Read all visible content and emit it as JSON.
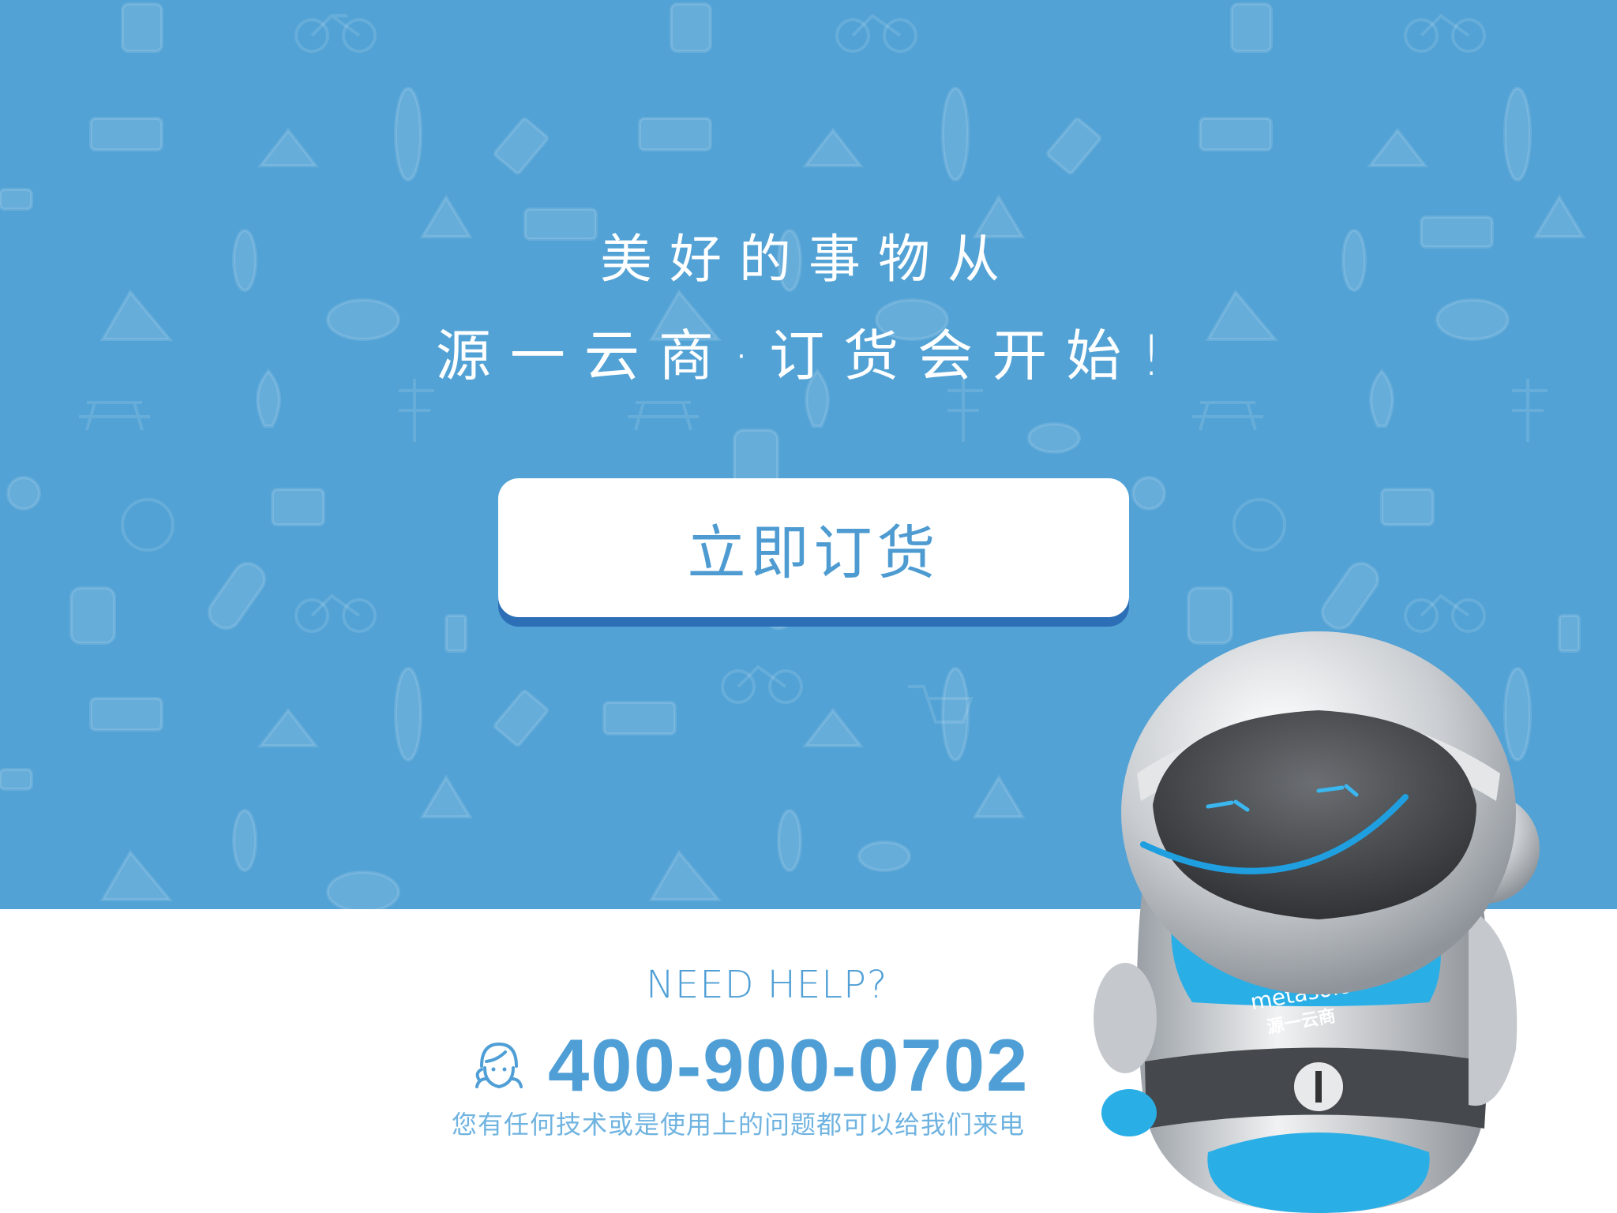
{
  "hero": {
    "headline_line1": "美好的事物从",
    "headline_line2": "源一云商·订货会开始!",
    "background_color": "#52a2d5"
  },
  "order_button": {
    "label": "立即订货"
  },
  "help": {
    "title": "NEED HELP?",
    "phone": "400-900-0702",
    "note": "您有任何技术或是使用上的问题都可以给我们来电",
    "icon": "customer-service-icon"
  },
  "robot": {
    "brand_en": "metasolo",
    "brand_cn": "源一云商"
  },
  "colors": {
    "accent": "#4f9fd6",
    "button_shadow": "#2d6fb6"
  }
}
